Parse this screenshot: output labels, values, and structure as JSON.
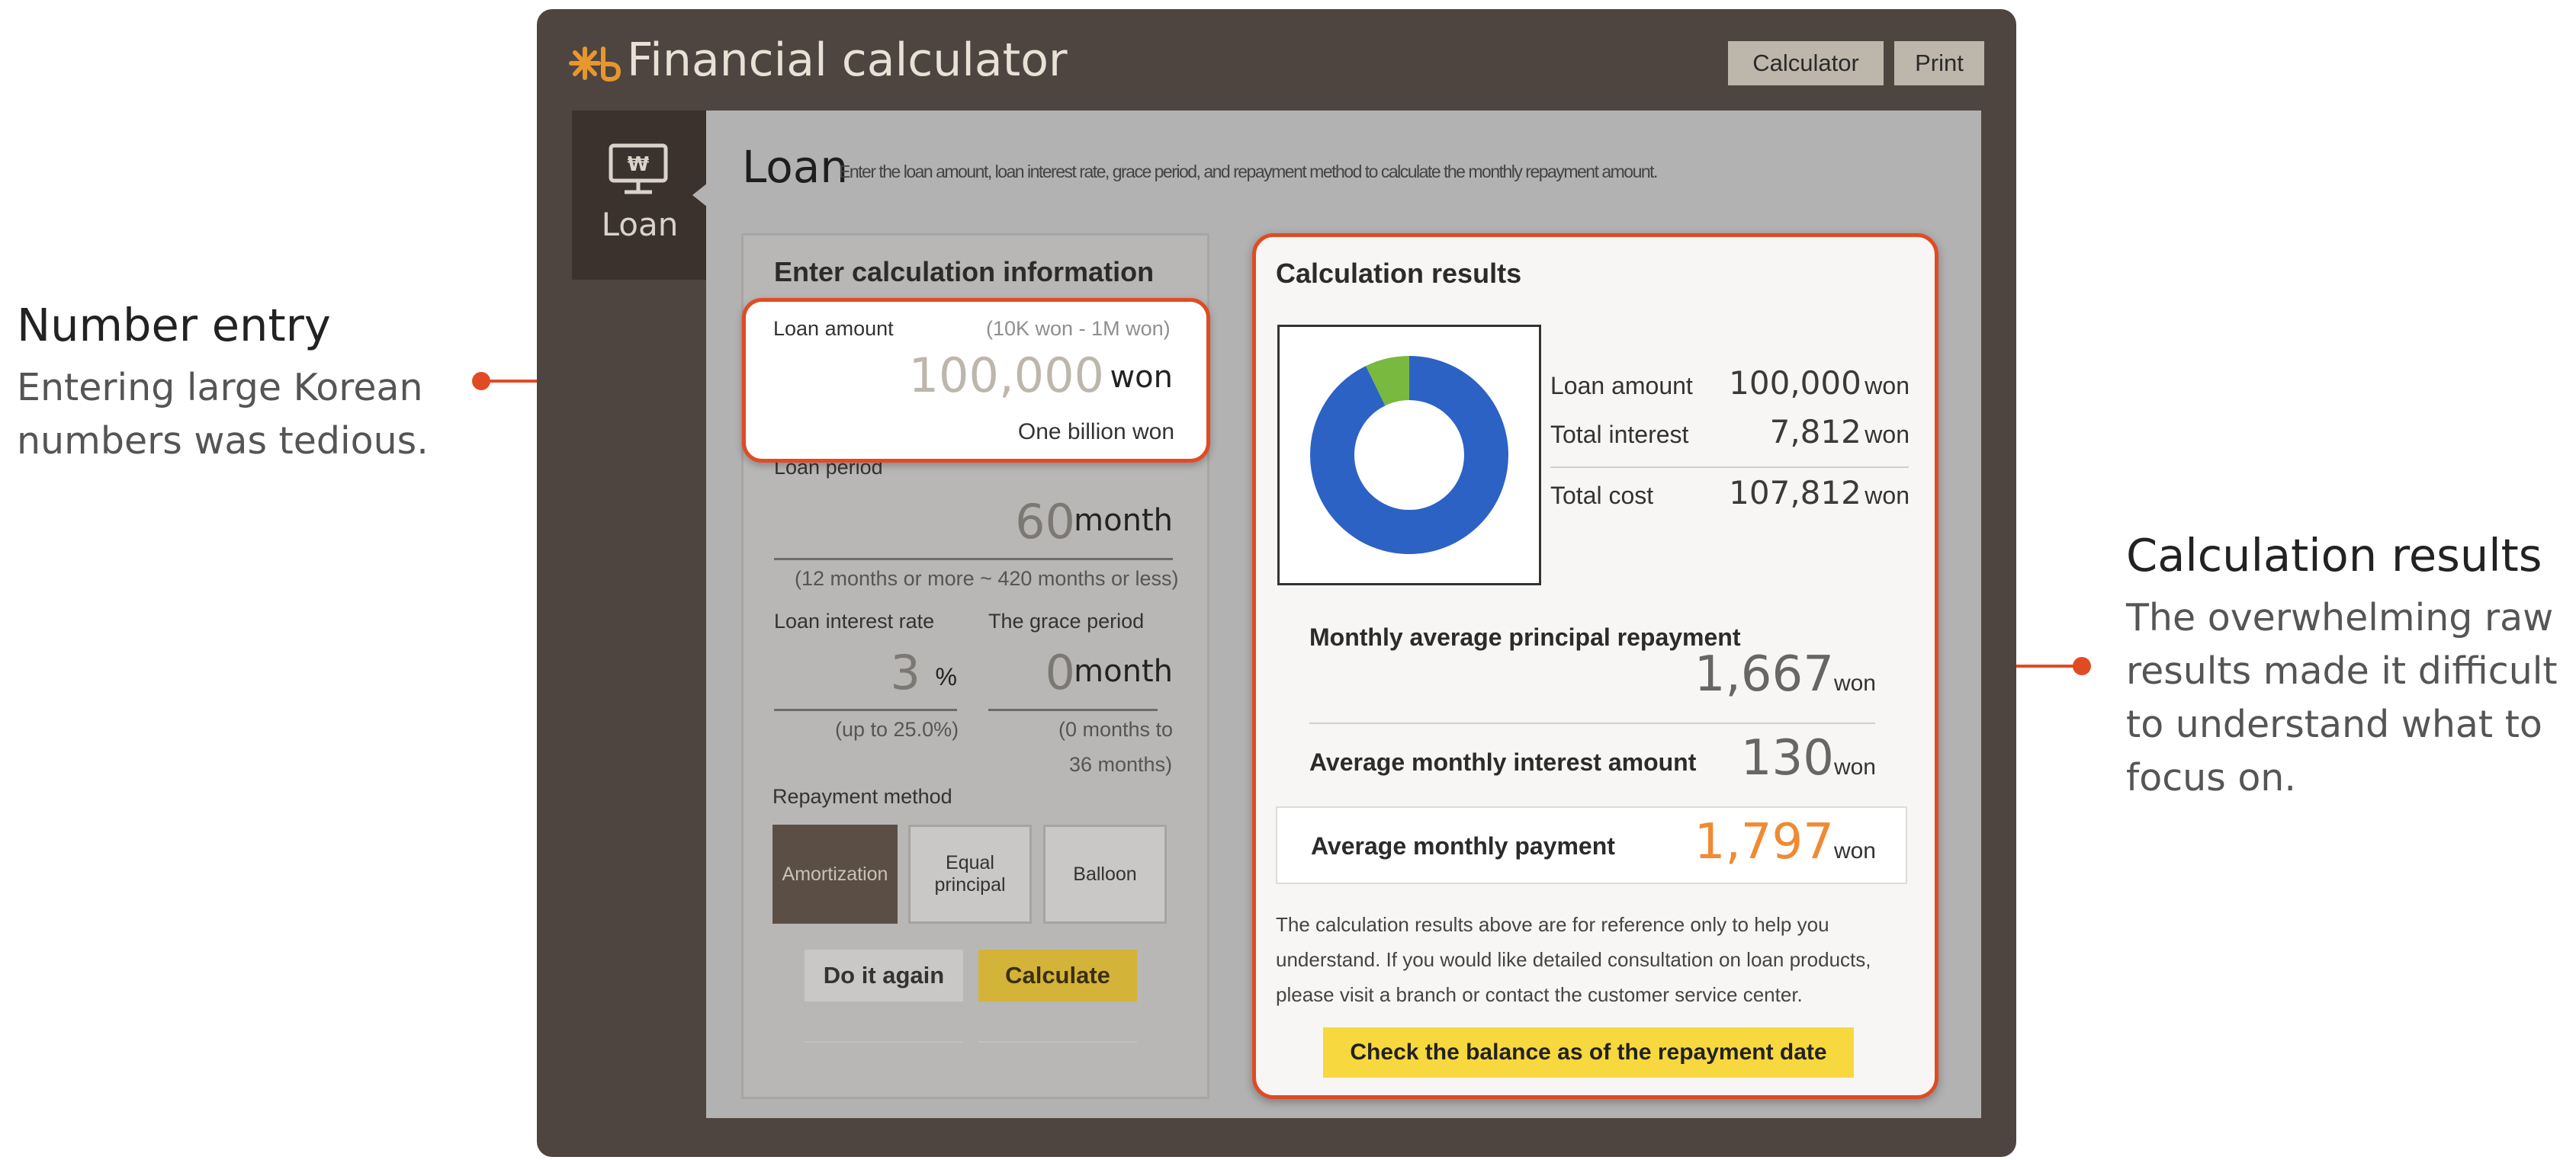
{
  "annotations": {
    "left": {
      "title": "Number entry",
      "body_line1": "Entering large Korean",
      "body_line2": "numbers was tedious."
    },
    "right": {
      "title": "Calculation results",
      "body_line1": "The overwhelming raw",
      "body_line2": "results made it difficult",
      "body_line3": "to understand what to",
      "body_line4": "focus on."
    }
  },
  "app": {
    "title": "Financial calculator",
    "calculator_button": "Calculator",
    "print_button": "Print",
    "side_tab_label": "Loan",
    "page_title": "Loan",
    "page_description": "Enter the loan amount, loan interest rate, grace period, and repayment method to calculate the monthly repayment amount."
  },
  "input": {
    "panel_title": "Enter calculation information",
    "loan_amount": {
      "label": "Loan amount",
      "range": "(10K won - 1M won)",
      "value": "100,000",
      "unit": "won",
      "korean_reading": "One billion won"
    },
    "loan_period": {
      "label": "Loan period",
      "value": "60",
      "unit": "month",
      "hint": "(12 months or more ~ 420 months or less)"
    },
    "interest_rate": {
      "label": "Loan interest rate",
      "value": "3",
      "unit": "%",
      "hint": "(up to 25.0%)"
    },
    "grace_period": {
      "label": "The grace period",
      "value": "0",
      "unit": "month",
      "hint_line1": "(0 months to",
      "hint_line2": "36 months)"
    },
    "repayment": {
      "label": "Repayment method",
      "option_amortization": "Amortization",
      "option_equal_line1": "Equal",
      "option_equal_line2": "principal",
      "option_balloon": "Balloon",
      "selected": "Amortization"
    },
    "do_again_button": "Do it again",
    "calculate_button": "Calculate"
  },
  "results": {
    "panel_title": "Calculation results",
    "loan_amount_label": "Loan amount",
    "loan_amount_value": "100,000",
    "total_interest_label": "Total interest",
    "total_interest_value": "7,812",
    "total_cost_label": "Total cost",
    "total_cost_value": "107,812",
    "unit": "won",
    "monthly_principal_label": "Monthly average principal repayment",
    "monthly_principal_value": "1,667",
    "monthly_interest_label": "Average monthly interest amount",
    "monthly_interest_value": "130",
    "monthly_payment_label": "Average monthly payment",
    "monthly_payment_value": "1,797",
    "note_line1": "The calculation results above are for reference only to help you",
    "note_line2": "understand. If you would like detailed consultation on loan products,",
    "note_line3": "please visit a branch or contact the customer service center.",
    "balance_button": "Check the balance as of the repayment date",
    "donut": {
      "principal_share": 0.9275,
      "interest_share": 0.0725,
      "principal_color": "#2d62c5",
      "interest_color": "#79b93f"
    }
  },
  "colors": {
    "accent": "#e04b24",
    "window_bg": "#4f4540",
    "highlight_value": "#f08a33",
    "calculate_button": "#d4b339",
    "balance_button": "#f7d83e"
  }
}
